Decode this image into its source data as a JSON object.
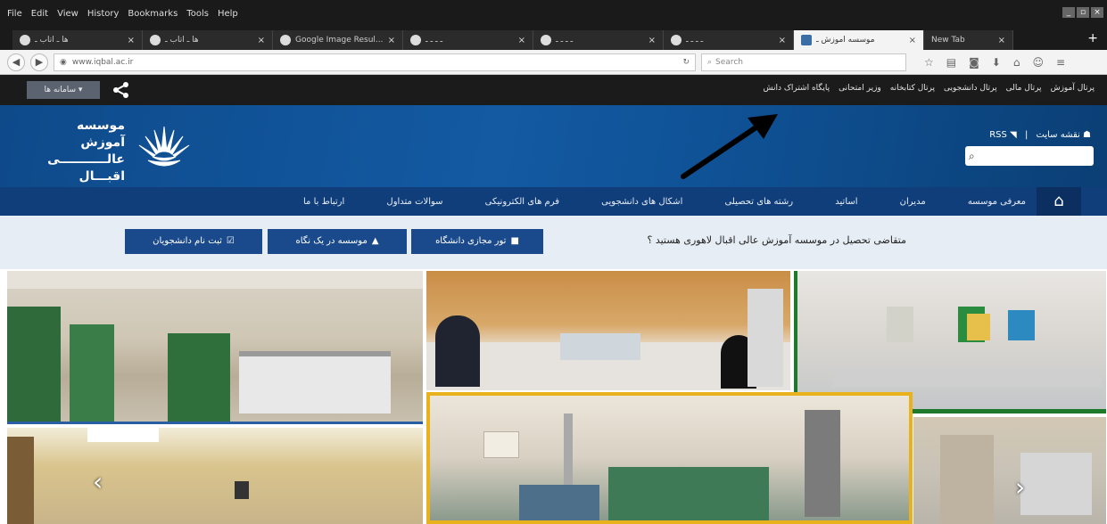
{
  "browser": {
    "menu": [
      "File",
      "Edit",
      "View",
      "History",
      "Bookmarks",
      "Tools",
      "Help"
    ],
    "window_controls": [
      "_",
      "▫",
      "×"
    ],
    "tabs": [
      {
        "title": "ها ـ اتاب ـ",
        "close": "×"
      },
      {
        "title": "ها ـ اتاب ـ",
        "close": "×"
      },
      {
        "title": "Google Image Resul...",
        "close": "×"
      },
      {
        "title": "ـ ـ ـ ـ",
        "close": "×"
      },
      {
        "title": "ـ ـ ـ ـ",
        "close": "×"
      },
      {
        "title": "ـ ـ ـ ـ",
        "close": "×"
      },
      {
        "title": "موسسه آموزش ـ",
        "close": "×",
        "active": true
      },
      {
        "title": "New Tab",
        "close": "×"
      }
    ],
    "new_tab_icon": "+",
    "url": "www.iqbal.ac.ir",
    "search_placeholder": "Search",
    "toolbar_icons": [
      "star-icon",
      "reading-list-icon",
      "pocket-icon",
      "download-icon",
      "home-icon",
      "sync-icon",
      "menu-icon"
    ]
  },
  "site": {
    "systems_button": "سامانه ها",
    "top_links": [
      "پرتال آموزش",
      "پرتال مالی",
      "پرتال دانشجویی",
      "پرتال کتابخانه",
      "وزیر امتحانی",
      "پایگاه اشتراک دانش"
    ],
    "logo_text": [
      "موسسه آموزش",
      "عالـــــــــــی",
      "اقبـــال لاهوری"
    ],
    "sitemap": "نقشه سایت",
    "rss": "RSS",
    "nav": [
      "معرفی موسسه",
      "مدیران",
      "اساتید",
      "رشته های تحصیلی",
      "اشکال های دانشجویی",
      "فرم های الکترونیکی",
      "سوالات متداول",
      "ارتباط با ما"
    ],
    "cta_question": "متقاضی تحصیل در موسسه آموزش عالی اقبال لاهوری هستید ؟",
    "cta_buttons": [
      {
        "label": "تور مجازی دانشگاه",
        "icon": "video-icon"
      },
      {
        "label": "موسسه در یک نگاه",
        "icon": "graduation-cap-icon"
      },
      {
        "label": "ثبت نام دانشجویان",
        "icon": "check-square-icon"
      }
    ],
    "slider_prev": "‹",
    "slider_next": "›"
  },
  "colors": {
    "header_blue": "#135aa3",
    "nav_blue": "#103e7a",
    "button_blue": "#1a4a8c",
    "cta_bg": "#e6edf4",
    "frame_yellow": "#e8b21c",
    "frame_green": "#1c7a2a"
  }
}
